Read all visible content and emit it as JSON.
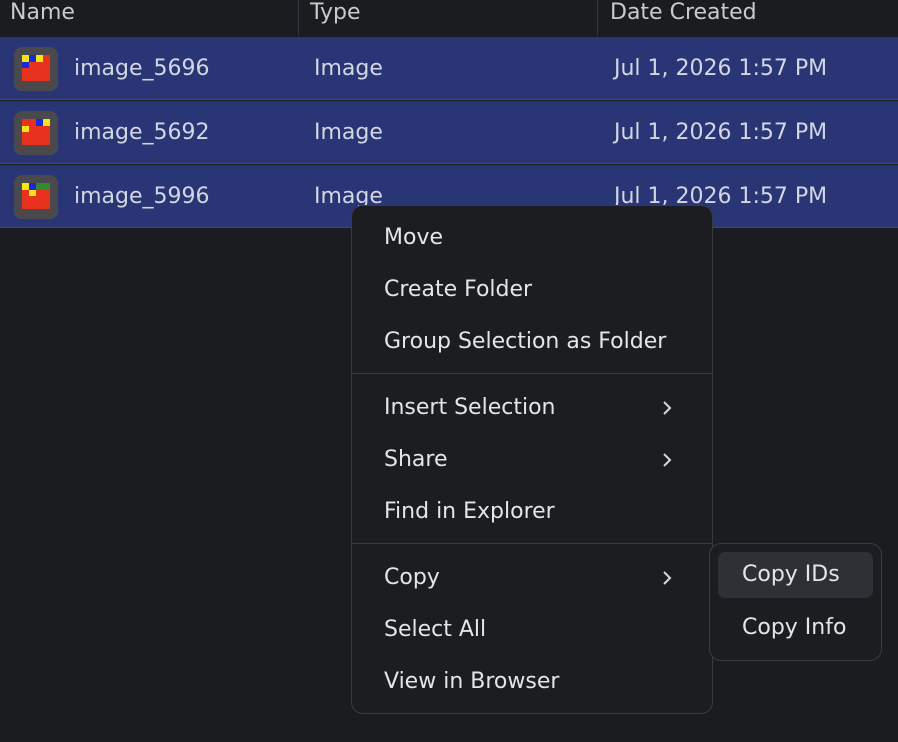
{
  "columns": {
    "name": "Name",
    "type": "Type",
    "date": "Date Created"
  },
  "rows": [
    {
      "name": "image_5696",
      "type": "Image",
      "date": "Jul 1, 2026 1:57 PM",
      "thumb": "image-thumbnail-icon"
    },
    {
      "name": "image_5692",
      "type": "Image",
      "date": "Jul 1, 2026 1:57 PM",
      "thumb": "image-thumbnail-icon"
    },
    {
      "name": "image_5996",
      "type": "Image",
      "date": "Jul 1, 2026 1:57 PM",
      "thumb": "image-thumbnail-icon"
    }
  ],
  "context_menu": {
    "items": [
      {
        "label": "Move"
      },
      {
        "label": "Create Folder"
      },
      {
        "label": "Group Selection as Folder"
      },
      {
        "label": "Insert Selection",
        "submenu": true
      },
      {
        "label": "Share",
        "submenu": true
      },
      {
        "label": "Find in Explorer"
      },
      {
        "label": "Copy",
        "submenu": true
      },
      {
        "label": "Select All"
      },
      {
        "label": "View in Browser"
      }
    ]
  },
  "copy_submenu": {
    "items": [
      {
        "label": "Copy IDs",
        "hovered": true
      },
      {
        "label": "Copy Info"
      }
    ]
  },
  "colors": {
    "background": "#1b1c20",
    "selected_row": "#2a3575",
    "menu_background": "#1c1d21",
    "thumb_red": "#e8321e",
    "thumb_yellow": "#f2e619",
    "thumb_blue": "#1a2adb",
    "thumb_green": "#2e8b2e"
  }
}
